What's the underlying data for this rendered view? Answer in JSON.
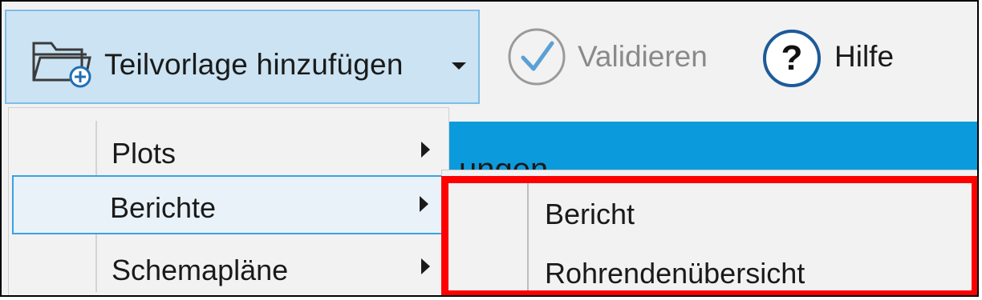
{
  "toolbar": {
    "add_subtemplate": {
      "label": "Teilvorlage hinzufügen",
      "icon": "folder-add-icon",
      "has_dropdown": true
    },
    "validate": {
      "label": "Validieren",
      "icon": "checkmark-circle-icon",
      "enabled": false
    },
    "help": {
      "label": "Hilfe",
      "icon": "question-circle-icon"
    }
  },
  "background_band": {
    "partial_text": "ungen",
    "color": "#0b9bdd"
  },
  "menu": {
    "items": [
      {
        "label": "Plots",
        "has_submenu": true
      },
      {
        "label": "Berichte",
        "has_submenu": true,
        "highlighted": true
      },
      {
        "label": "Schemapläne",
        "has_submenu": true
      }
    ]
  },
  "submenu": {
    "items": [
      {
        "label": "Bericht"
      },
      {
        "label": "Rohrendenübersicht"
      }
    ]
  },
  "annotation": {
    "color": "#ff0000"
  },
  "colors": {
    "accent_blue": "#39a3e0",
    "button_active_bg": "#cbe3f2",
    "menu_bg": "#f2f2f2"
  }
}
